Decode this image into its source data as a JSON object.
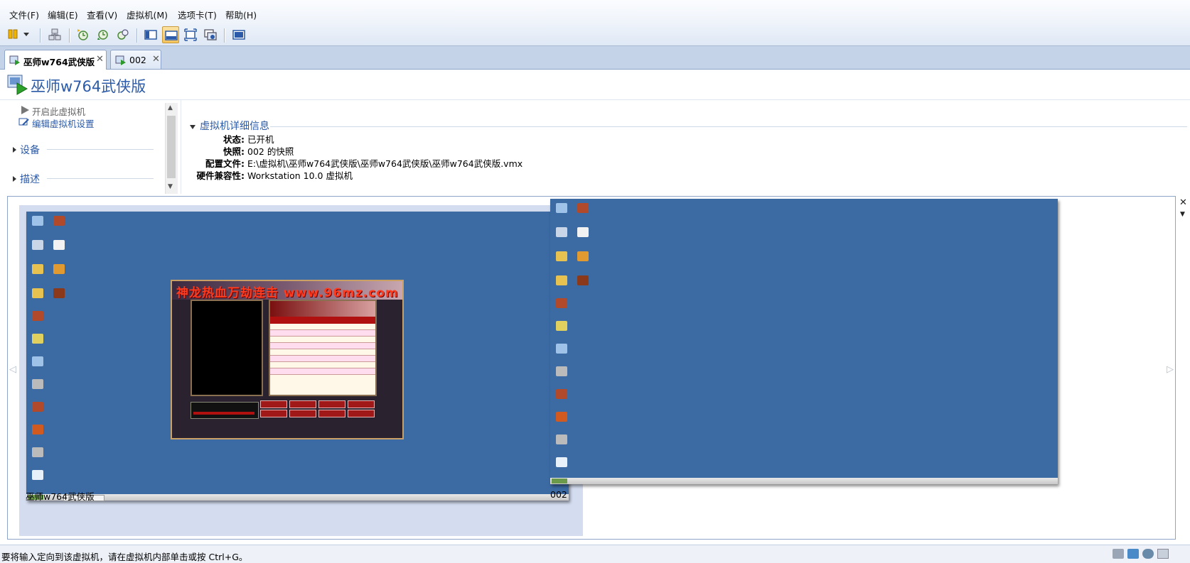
{
  "menu": [
    "文件(F)",
    "编辑(E)",
    "查看(V)",
    "虚拟机(M)",
    "选项卡(T)",
    "帮助(H)"
  ],
  "tabs": [
    {
      "label": "巫师w764武侠版",
      "active": true
    },
    {
      "label": "002",
      "active": false
    }
  ],
  "vm": {
    "title": "巫师w764武侠版"
  },
  "actions": {
    "power_on": "开启此虚拟机",
    "edit_settings": "编辑虚拟机设置"
  },
  "sections": {
    "devices": "设备",
    "description": "描述"
  },
  "details": {
    "title": "虚拟机详细信息",
    "rows": [
      {
        "label": "状态:",
        "value": "已开机"
      },
      {
        "label": "快照:",
        "value": "002 的快照"
      },
      {
        "label": "配置文件:",
        "value": "E:\\虚拟机\\巫师w764武侠版\\巫师w764武侠版\\巫师w764武侠版.vmx"
      },
      {
        "label": "硬件兼容性:",
        "value": "Workstation 10.0 虚拟机"
      }
    ]
  },
  "thumbnails": [
    {
      "caption": "巫师w764武侠版",
      "selected": true
    },
    {
      "caption": "002",
      "selected": false
    }
  ],
  "game_window": {
    "banner": "神龙热血万劫连击 www.96mz.com"
  },
  "status": {
    "text": "要将输入定向到该虚拟机，请在虚拟机内部单击或按 Ctrl+G。"
  },
  "colors": {
    "accent": "#2b5aa8",
    "desktop": "#3c6aa3",
    "toolbar": "#dfe8f5",
    "selection": "#d4ddf0"
  },
  "icons": [
    "pause-icon",
    "network-icon",
    "snapshot-take-icon",
    "snapshot-revert-icon",
    "snapshot-manager-icon",
    "view-console-icon",
    "view-thumbnail-icon",
    "fullscreen-icon",
    "unity-icon",
    "display-icon"
  ]
}
